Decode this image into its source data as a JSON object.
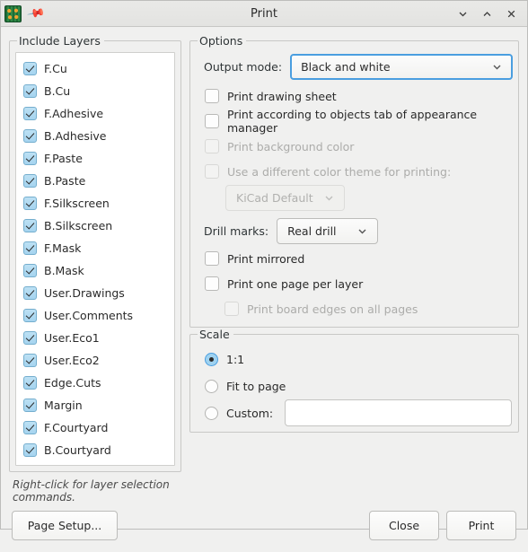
{
  "titlebar": {
    "title": "Print",
    "app_icon": "kicad-pcb-icon",
    "pin_icon": "pin-icon",
    "minimize_icon": "chevron-down-icon",
    "maximize_icon": "chevron-up-icon",
    "close_icon": "close-icon"
  },
  "include_layers": {
    "legend": "Include Layers",
    "hint": "Right-click for layer selection commands.",
    "items": [
      {
        "label": "F.Cu",
        "checked": true
      },
      {
        "label": "B.Cu",
        "checked": true
      },
      {
        "label": "F.Adhesive",
        "checked": true
      },
      {
        "label": "B.Adhesive",
        "checked": true
      },
      {
        "label": "F.Paste",
        "checked": true
      },
      {
        "label": "B.Paste",
        "checked": true
      },
      {
        "label": "F.Silkscreen",
        "checked": true
      },
      {
        "label": "B.Silkscreen",
        "checked": true
      },
      {
        "label": "F.Mask",
        "checked": true
      },
      {
        "label": "B.Mask",
        "checked": true
      },
      {
        "label": "User.Drawings",
        "checked": true
      },
      {
        "label": "User.Comments",
        "checked": true
      },
      {
        "label": "User.Eco1",
        "checked": true
      },
      {
        "label": "User.Eco2",
        "checked": true
      },
      {
        "label": "Edge.Cuts",
        "checked": true
      },
      {
        "label": "Margin",
        "checked": true
      },
      {
        "label": "F.Courtyard",
        "checked": true
      },
      {
        "label": "B.Courtyard",
        "checked": true
      }
    ]
  },
  "options": {
    "legend": "Options",
    "output_mode_label": "Output mode:",
    "output_mode_value": "Black and white",
    "print_drawing_sheet": {
      "label": "Print drawing sheet",
      "checked": false,
      "disabled": false
    },
    "print_according_objects": {
      "label": "Print according to objects tab of appearance manager",
      "checked": false,
      "disabled": false
    },
    "print_background_color": {
      "label": "Print background color",
      "checked": false,
      "disabled": true
    },
    "use_different_theme": {
      "label": "Use a different color theme for printing:",
      "checked": false,
      "disabled": true
    },
    "color_theme_value": "KiCad Default",
    "drill_marks_label": "Drill marks:",
    "drill_marks_value": "Real drill",
    "print_mirrored": {
      "label": "Print mirrored",
      "checked": false,
      "disabled": false
    },
    "print_one_page_per_layer": {
      "label": "Print one page per layer",
      "checked": false,
      "disabled": false
    },
    "print_board_edges": {
      "label": "Print board edges on all pages",
      "checked": false,
      "disabled": true
    }
  },
  "scale": {
    "legend": "Scale",
    "option_1to1": "1:1",
    "option_fit": "Fit to page",
    "option_custom": "Custom:",
    "selected": "1:1",
    "custom_value": ""
  },
  "footer": {
    "page_setup": "Page Setup...",
    "close": "Close",
    "print": "Print"
  },
  "colors": {
    "accent_focus": "#4a9ee0",
    "checkbox_fill": "#a5d4ef",
    "dialog_bg": "#f0f0ef",
    "list_bg": "#ffffff"
  }
}
